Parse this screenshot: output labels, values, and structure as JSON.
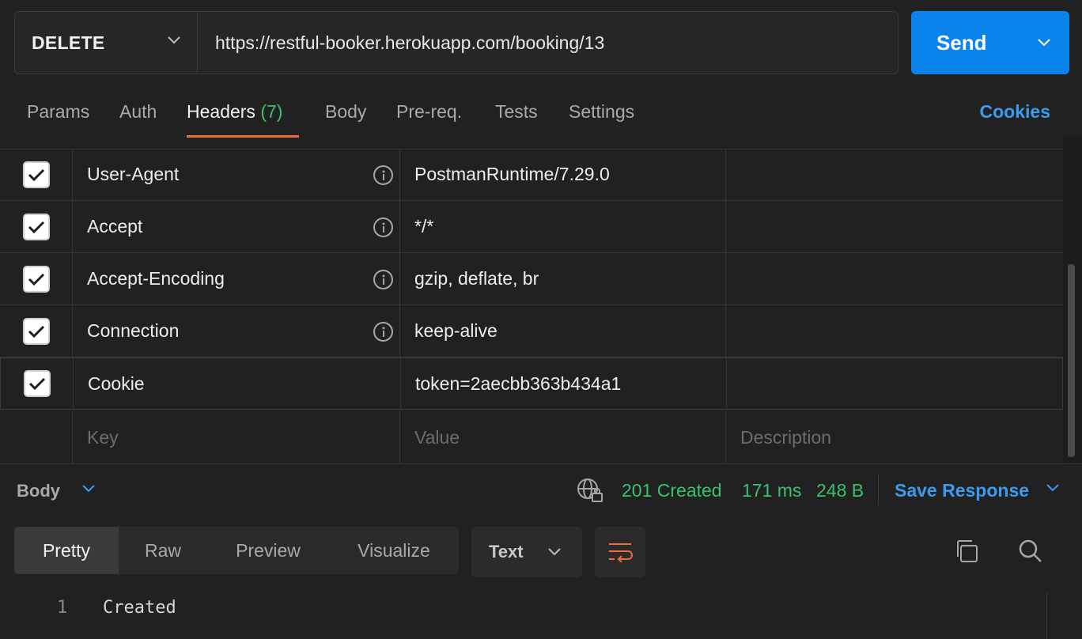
{
  "request": {
    "method": "DELETE",
    "url": "https://restful-booker.herokuapp.com/booking/13",
    "send_label": "Send"
  },
  "tabs": {
    "items": [
      {
        "label": "Params"
      },
      {
        "label": "Auth"
      },
      {
        "label": "Headers",
        "count": "(7)",
        "active": true
      },
      {
        "label": "Body"
      },
      {
        "label": "Pre-req."
      },
      {
        "label": "Tests"
      },
      {
        "label": "Settings"
      }
    ],
    "cookies_label": "Cookies"
  },
  "headers": {
    "rows": [
      {
        "key": "User-Agent",
        "value": "PostmanRuntime/7.29.0",
        "checked": true,
        "info": true
      },
      {
        "key": "Accept",
        "value": "*/*",
        "checked": true,
        "info": true
      },
      {
        "key": "Accept-Encoding",
        "value": "gzip, deflate, br",
        "checked": true,
        "info": true
      },
      {
        "key": "Connection",
        "value": "keep-alive",
        "checked": true,
        "info": true
      },
      {
        "key": "Cookie",
        "value": "token=2aecbb363b434a1",
        "checked": true,
        "info": false
      }
    ],
    "placeholders": {
      "key": "Key",
      "value": "Value",
      "description": "Description"
    }
  },
  "response": {
    "body_label": "Body",
    "status": "201 Created",
    "time": "171 ms",
    "size": "248 B",
    "save_label": "Save Response",
    "view_tabs": [
      "Pretty",
      "Raw",
      "Preview",
      "Visualize"
    ],
    "active_view": "Pretty",
    "format": "Text",
    "lines": [
      {
        "num": "1",
        "text": "Created"
      }
    ]
  },
  "colors": {
    "accent_blue": "#0a84ea",
    "link_blue": "#3a9bf0",
    "status_green": "#37c26f",
    "tab_underline": "#f06d3b"
  }
}
